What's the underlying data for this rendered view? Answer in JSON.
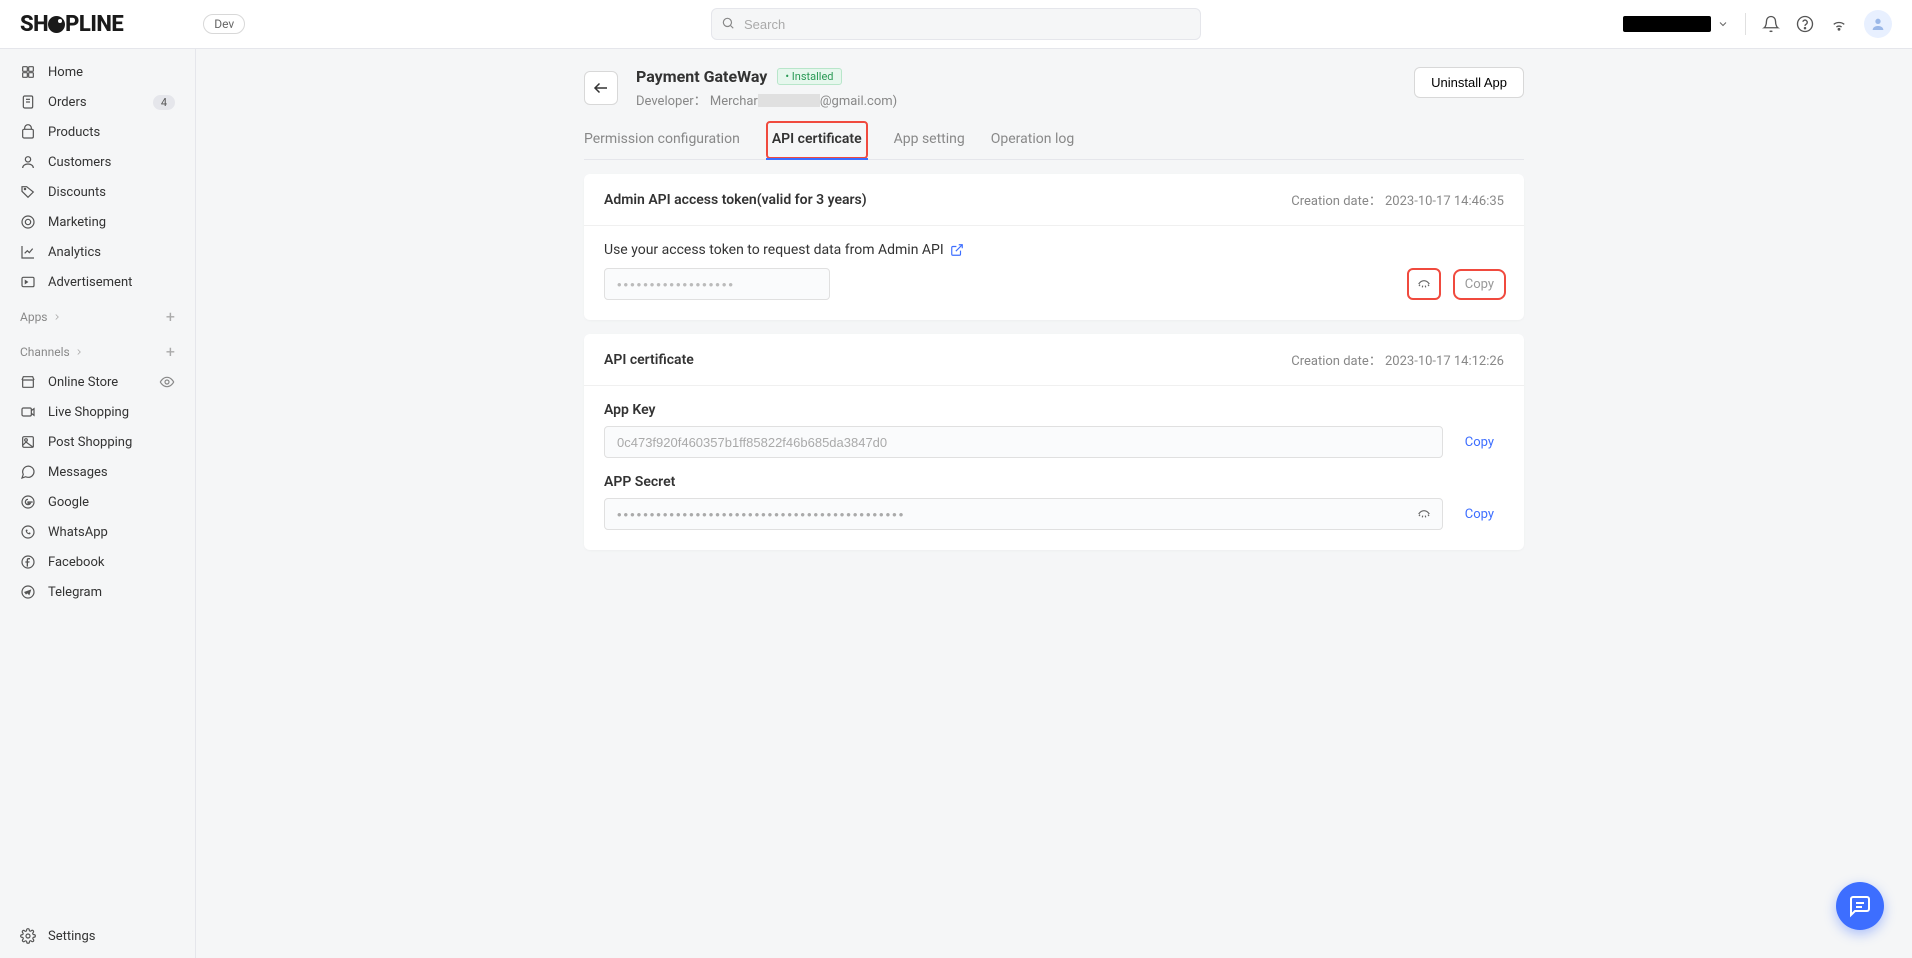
{
  "header": {
    "logo_text": "SHOPLINE",
    "dev_badge": "Dev",
    "search_placeholder": "Search"
  },
  "sidebar": {
    "main": [
      {
        "icon": "home",
        "label": "Home"
      },
      {
        "icon": "orders",
        "label": "Orders",
        "badge": "4"
      },
      {
        "icon": "products",
        "label": "Products"
      },
      {
        "icon": "customers",
        "label": "Customers"
      },
      {
        "icon": "discounts",
        "label": "Discounts"
      },
      {
        "icon": "marketing",
        "label": "Marketing"
      },
      {
        "icon": "analytics",
        "label": "Analytics"
      },
      {
        "icon": "advertisement",
        "label": "Advertisement"
      }
    ],
    "apps_header": "Apps",
    "channels_header": "Channels",
    "channels": [
      {
        "icon": "online-store",
        "label": "Online Store",
        "eye": true
      },
      {
        "icon": "live-shopping",
        "label": "Live Shopping"
      },
      {
        "icon": "post-shopping",
        "label": "Post Shopping"
      },
      {
        "icon": "messages",
        "label": "Messages"
      },
      {
        "icon": "google",
        "label": "Google"
      },
      {
        "icon": "whatsapp",
        "label": "WhatsApp"
      },
      {
        "icon": "facebook",
        "label": "Facebook"
      },
      {
        "icon": "telegram",
        "label": "Telegram"
      }
    ],
    "settings": "Settings"
  },
  "page": {
    "title": "Payment GateWay",
    "installed_badge": "• Installed",
    "developer_label": "Developer：",
    "developer_prefix": "Merchar",
    "developer_suffix": "@gmail.com)",
    "uninstall": "Uninstall App"
  },
  "tabs": [
    {
      "label": "Permission configuration",
      "active": false
    },
    {
      "label": "API certificate",
      "active": true,
      "highlight": true
    },
    {
      "label": "App setting",
      "active": false
    },
    {
      "label": "Operation log",
      "active": false
    }
  ],
  "section_token": {
    "title": "Admin API access token(valid for 3 years)",
    "creation_label": "Creation date：",
    "creation_date": "2023-10-17 14:46:35",
    "instruction": "Use your access token to request data from Admin API",
    "masked_value": "••••••••••••••••••",
    "copy_label": "Copy"
  },
  "section_cert": {
    "title": "API certificate",
    "creation_label": "Creation date：",
    "creation_date": "2023-10-17 14:12:26",
    "app_key_label": "App Key",
    "app_key_value": "0c473f920f460357b1ff85822f46b685da3847d0",
    "app_secret_label": "APP Secret",
    "app_secret_value": "••••••••••••••••••••••••••••••••••••••••••••",
    "copy_label": "Copy"
  }
}
